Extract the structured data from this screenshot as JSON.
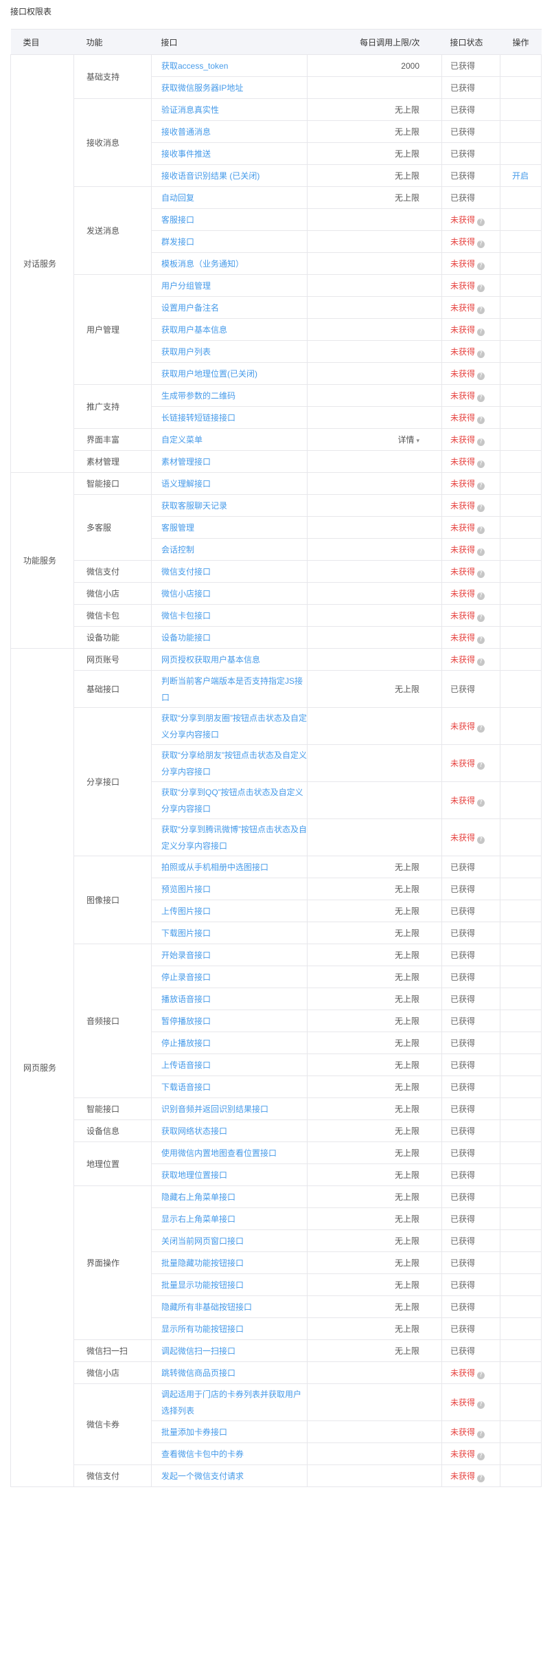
{
  "title": "接口权限表",
  "columns": {
    "category": "类目",
    "function": "功能",
    "interface": "接口",
    "limit": "每日调用上限/次",
    "status": "接口状态",
    "operation": "操作"
  },
  "status_labels": {
    "got": "已获得",
    "not": "未获得"
  },
  "colors": {
    "link": "#459ae9",
    "not_obtained": "#e64340",
    "header_bg": "#f4f5f9",
    "border": "#e7e7eb"
  },
  "categories": [
    {
      "name": "对话服务",
      "groups": [
        {
          "name": "基础支持",
          "rows": [
            {
              "iface": "获取access_token",
              "limit": "2000",
              "status": "got",
              "h": 32
            },
            {
              "iface": "获取微信服务器IP地址",
              "limit": "",
              "status": "got",
              "h": 32
            }
          ]
        },
        {
          "name": "接收消息",
          "rows": [
            {
              "iface": "验证消息真实性",
              "limit": "无上限",
              "status": "got",
              "h": 32
            },
            {
              "iface": "接收普通消息",
              "limit": "无上限",
              "status": "got",
              "h": 32
            },
            {
              "iface": "接收事件推送",
              "limit": "无上限",
              "status": "got",
              "h": 32
            },
            {
              "iface": "接收语音识别结果 (已关闭)",
              "limit": "无上限",
              "status": "got",
              "op": "开启",
              "h": 32
            }
          ]
        },
        {
          "name": "发送消息",
          "rows": [
            {
              "iface": "自动回复",
              "limit": "无上限",
              "status": "got",
              "h": 32
            },
            {
              "iface": "客服接口",
              "limit": "",
              "status": "not",
              "h": 32
            },
            {
              "iface": "群发接口",
              "limit": "",
              "status": "not",
              "h": 32
            },
            {
              "iface": "模板消息（业务通知）",
              "limit": "",
              "status": "not",
              "h": 32
            }
          ]
        },
        {
          "name": "用户管理",
          "rows": [
            {
              "iface": "用户分组管理",
              "limit": "",
              "status": "not",
              "h": 32
            },
            {
              "iface": "设置用户备注名",
              "limit": "",
              "status": "not",
              "h": 32
            },
            {
              "iface": "获取用户基本信息",
              "limit": "",
              "status": "not",
              "h": 32
            },
            {
              "iface": "获取用户列表",
              "limit": "",
              "status": "not",
              "h": 32
            },
            {
              "iface": "获取用户地理位置(已关闭)",
              "limit": "",
              "status": "not",
              "h": 32
            }
          ]
        },
        {
          "name": "推广支持",
          "rows": [
            {
              "iface": "生成带参数的二维码",
              "limit": "",
              "status": "not",
              "h": 32
            },
            {
              "iface": "长链接转短链接接口",
              "limit": "",
              "status": "not",
              "h": 32
            }
          ]
        },
        {
          "name": "界面丰富",
          "rows": [
            {
              "iface": "自定义菜单",
              "limit": "详情",
              "status": "not",
              "caret": true,
              "h": 32
            }
          ]
        },
        {
          "name": "素材管理",
          "rows": [
            {
              "iface": "素材管理接口",
              "limit": "",
              "status": "not",
              "h": 32
            }
          ]
        }
      ]
    },
    {
      "name": "功能服务",
      "groups": [
        {
          "name": "智能接口",
          "rows": [
            {
              "iface": "语义理解接口",
              "limit": "",
              "status": "not",
              "h": 32
            }
          ]
        },
        {
          "name": "多客服",
          "rows": [
            {
              "iface": "获取客服聊天记录",
              "limit": "",
              "status": "not",
              "h": 32
            },
            {
              "iface": "客服管理",
              "limit": "",
              "status": "not",
              "h": 32
            },
            {
              "iface": "会话控制",
              "limit": "",
              "status": "not",
              "h": 32
            }
          ]
        },
        {
          "name": "微信支付",
          "rows": [
            {
              "iface": "微信支付接口",
              "limit": "",
              "status": "not",
              "h": 32
            }
          ]
        },
        {
          "name": "微信小店",
          "rows": [
            {
              "iface": "微信小店接口",
              "limit": "",
              "status": "not",
              "h": 32
            }
          ]
        },
        {
          "name": "微信卡包",
          "rows": [
            {
              "iface": "微信卡包接口",
              "limit": "",
              "status": "not",
              "h": 32
            }
          ]
        },
        {
          "name": "设备功能",
          "rows": [
            {
              "iface": "设备功能接口",
              "limit": "",
              "status": "not",
              "h": 32
            }
          ]
        }
      ]
    },
    {
      "name": "网页服务",
      "groups": [
        {
          "name": "网页账号",
          "rows": [
            {
              "iface": "网页授权获取用户基本信息",
              "limit": "",
              "status": "not",
              "h": 32
            }
          ]
        },
        {
          "name": "基础接口",
          "rows": [
            {
              "iface": "判断当前客户端版本是否支持指定JS接口",
              "limit": "无上限",
              "status": "got",
              "h": 54
            }
          ]
        },
        {
          "name": "分享接口",
          "rows": [
            {
              "iface": "获取“分享到朋友圈”按钮点击状态及自定义分享内容接口",
              "limit": "",
              "status": "not",
              "h": 54
            },
            {
              "iface": "获取“分享给朋友”按钮点击状态及自定义分享内容接口",
              "limit": "",
              "status": "not",
              "h": 54
            },
            {
              "iface": "获取“分享到QQ”按钮点击状态及自定义分享内容接口",
              "limit": "",
              "status": "not",
              "h": 54
            },
            {
              "iface": "获取“分享到腾讯微博”按钮点击状态及自定义分享内容接口",
              "limit": "",
              "status": "not",
              "h": 54
            }
          ]
        },
        {
          "name": "图像接口",
          "rows": [
            {
              "iface": "拍照或从手机相册中选图接口",
              "limit": "无上限",
              "status": "got",
              "h": 32
            },
            {
              "iface": "预览图片接口",
              "limit": "无上限",
              "status": "got",
              "h": 32
            },
            {
              "iface": "上传图片接口",
              "limit": "无上限",
              "status": "got",
              "h": 32
            },
            {
              "iface": "下载图片接口",
              "limit": "无上限",
              "status": "got",
              "h": 32
            }
          ]
        },
        {
          "name": "音频接口",
          "rows": [
            {
              "iface": "开始录音接口",
              "limit": "无上限",
              "status": "got",
              "h": 32
            },
            {
              "iface": "停止录音接口",
              "limit": "无上限",
              "status": "got",
              "h": 32
            },
            {
              "iface": "播放语音接口",
              "limit": "无上限",
              "status": "got",
              "h": 32
            },
            {
              "iface": "暂停播放接口",
              "limit": "无上限",
              "status": "got",
              "h": 32
            },
            {
              "iface": "停止播放接口",
              "limit": "无上限",
              "status": "got",
              "h": 32
            },
            {
              "iface": "上传语音接口",
              "limit": "无上限",
              "status": "got",
              "h": 32
            },
            {
              "iface": "下载语音接口",
              "limit": "无上限",
              "status": "got",
              "h": 32
            }
          ]
        },
        {
          "name": "智能接口",
          "rows": [
            {
              "iface": "识别音频并返回识别结果接口",
              "limit": "无上限",
              "status": "got",
              "h": 32
            }
          ]
        },
        {
          "name": "设备信息",
          "rows": [
            {
              "iface": "获取网络状态接口",
              "limit": "无上限",
              "status": "got",
              "h": 32
            }
          ]
        },
        {
          "name": "地理位置",
          "rows": [
            {
              "iface": "使用微信内置地图查看位置接口",
              "limit": "无上限",
              "status": "got",
              "h": 32
            },
            {
              "iface": "获取地理位置接口",
              "limit": "无上限",
              "status": "got",
              "h": 32
            }
          ]
        },
        {
          "name": "界面操作",
          "rows": [
            {
              "iface": "隐藏右上角菜单接口",
              "limit": "无上限",
              "status": "got",
              "h": 32
            },
            {
              "iface": "显示右上角菜单接口",
              "limit": "无上限",
              "status": "got",
              "h": 32
            },
            {
              "iface": "关闭当前网页窗口接口",
              "limit": "无上限",
              "status": "got",
              "h": 32
            },
            {
              "iface": "批量隐藏功能按钮接口",
              "limit": "无上限",
              "status": "got",
              "h": 32
            },
            {
              "iface": "批量显示功能按钮接口",
              "limit": "无上限",
              "status": "got",
              "h": 32
            },
            {
              "iface": "隐藏所有非基础按钮接口",
              "limit": "无上限",
              "status": "got",
              "h": 32
            },
            {
              "iface": "显示所有功能按钮接口",
              "limit": "无上限",
              "status": "got",
              "h": 32
            }
          ]
        },
        {
          "name": "微信扫一扫",
          "rows": [
            {
              "iface": "调起微信扫一扫接口",
              "limit": "无上限",
              "status": "got",
              "h": 32
            }
          ]
        },
        {
          "name": "微信小店",
          "rows": [
            {
              "iface": "跳转微信商品页接口",
              "limit": "",
              "status": "not",
              "h": 32
            }
          ]
        },
        {
          "name": "微信卡券",
          "rows": [
            {
              "iface": "调起适用于门店的卡券列表并获取用户选择列表",
              "limit": "",
              "status": "not",
              "h": 54
            },
            {
              "iface": "批量添加卡券接口",
              "limit": "",
              "status": "not",
              "h": 32
            },
            {
              "iface": "查看微信卡包中的卡券",
              "limit": "",
              "status": "not",
              "h": 32
            }
          ]
        },
        {
          "name": "微信支付",
          "rows": [
            {
              "iface": "发起一个微信支付请求",
              "limit": "",
              "status": "not",
              "h": 32
            }
          ]
        }
      ]
    }
  ]
}
